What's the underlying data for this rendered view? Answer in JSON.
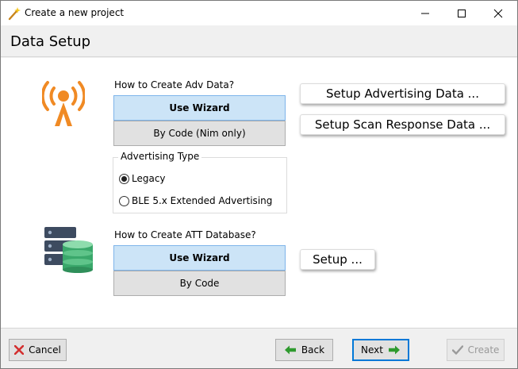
{
  "window": {
    "title": "Create a new project",
    "app_icon": "wand-icon"
  },
  "header": {
    "title": "Data Setup"
  },
  "adv": {
    "icon": "broadcast-antenna-icon",
    "question": "How to Create Adv Data?",
    "options": [
      {
        "label": "Use Wizard",
        "selected": true
      },
      {
        "label": "By Code (Nim only)",
        "selected": false
      }
    ],
    "setup_adv_label": "Setup Advertising Data ...",
    "setup_scan_label": "Setup Scan Response Data ...",
    "type_group": {
      "legend": "Advertising Type",
      "options": [
        {
          "label": "Legacy",
          "checked": true
        },
        {
          "label": "BLE 5.x Extended Advertising",
          "checked": false
        }
      ]
    }
  },
  "att": {
    "icon": "database-server-icon",
    "question": "How to Create ATT Database?",
    "options": [
      {
        "label": "Use Wizard",
        "selected": true
      },
      {
        "label": "By Code",
        "selected": false
      }
    ],
    "setup_label": "Setup ..."
  },
  "footer": {
    "cancel_label": "Cancel",
    "back_label": "Back",
    "next_label": "Next",
    "create_label": "Create"
  },
  "colors": {
    "accent_orange": "#f08a24",
    "selected_blue": "#cce4f7",
    "focus_blue": "#0078d7",
    "arrow_green": "#2e9a2e",
    "cancel_red": "#d32f2f"
  }
}
